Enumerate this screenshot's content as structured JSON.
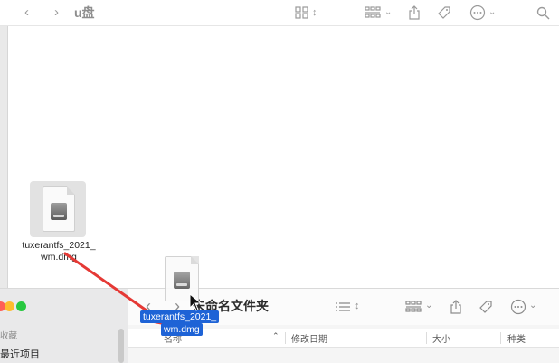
{
  "back_window": {
    "title": "u盘",
    "toolbar_icons": [
      "chevron-left-icon",
      "chevron-right-icon",
      "grid-view-icon",
      "group-by-icon",
      "share-icon",
      "tag-icon",
      "more-icon",
      "search-icon"
    ],
    "file": {
      "name": "tuxerantfs_2021_wm.dmg",
      "label_line1": "tuxerantfs_2021_",
      "label_line2": "wm.dmg"
    }
  },
  "front_window": {
    "title": "未命名文件夹",
    "sidebar": {
      "section_label": "收藏",
      "items": [
        "最近项目"
      ]
    },
    "columns": {
      "name": "名称",
      "date_modified": "修改日期",
      "size": "大小",
      "kind": "种类"
    }
  },
  "drag": {
    "label_line1": "tuxerantfs_2021_",
    "label_line2": "wm.dmg",
    "arrow_color": "#e53935",
    "selection_color": "#1e63d6"
  },
  "colors": {
    "traffic_red": "#ff5f57",
    "traffic_yellow": "#febc2e",
    "traffic_green": "#28c840"
  }
}
